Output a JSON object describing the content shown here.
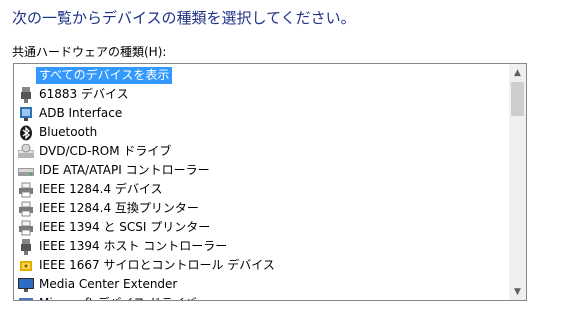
{
  "heading": "次の一覧からデバイスの種類を選択してください。",
  "list_label": "共通ハードウェアの種類(H):",
  "items": [
    {
      "label": "すべてのデバイスを表示",
      "icon": "none",
      "selected": true
    },
    {
      "label": "61883 デバイス",
      "icon": "port-connector-icon"
    },
    {
      "label": "ADB Interface",
      "icon": "usb-device-icon"
    },
    {
      "label": "Bluetooth",
      "icon": "bluetooth-icon"
    },
    {
      "label": "DVD/CD-ROM ドライブ",
      "icon": "optical-drive-icon"
    },
    {
      "label": "IDE ATA/ATAPI コントローラー",
      "icon": "disk-controller-icon"
    },
    {
      "label": "IEEE 1284.4 デバイス",
      "icon": "printer-icon"
    },
    {
      "label": "IEEE 1284.4 互換プリンター",
      "icon": "printer-icon"
    },
    {
      "label": "IEEE 1394 と SCSI プリンター",
      "icon": "printer-icon"
    },
    {
      "label": "IEEE 1394 ホスト コントローラー",
      "icon": "port-connector-icon"
    },
    {
      "label": "IEEE 1667 サイロとコントロール デバイス",
      "icon": "security-device-icon"
    },
    {
      "label": "Media Center Extender",
      "icon": "monitor-icon"
    },
    {
      "label": "Microsoft デバイス ドライバ",
      "icon": "device-icon"
    }
  ],
  "scrollbar": {
    "up": "▲",
    "down": "▼"
  }
}
